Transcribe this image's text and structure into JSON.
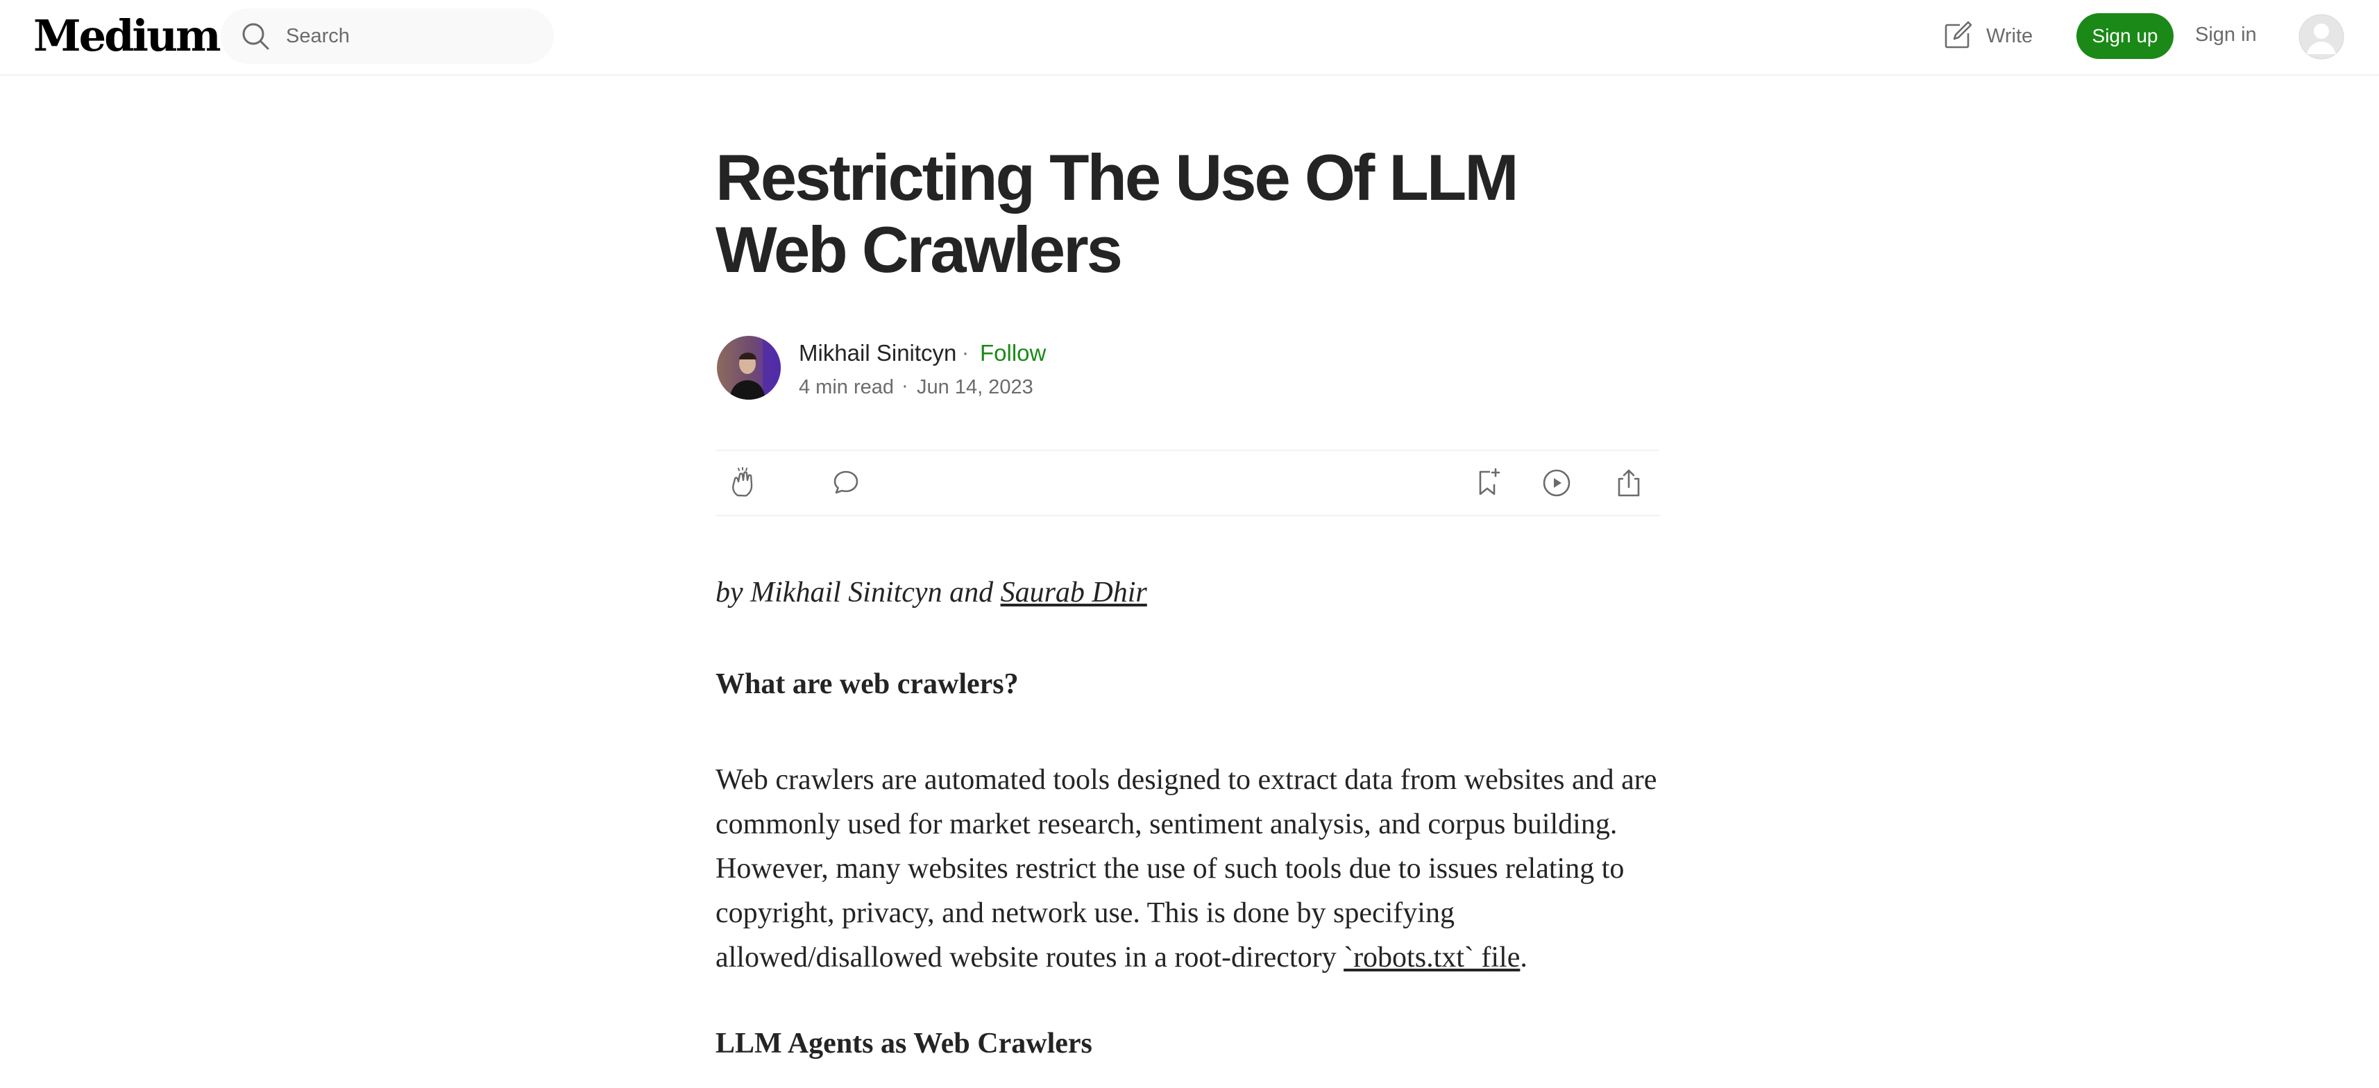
{
  "nav": {
    "logo": "Medium",
    "search_placeholder": "Search",
    "write_label": "Write",
    "signup_label": "Sign up",
    "signin_label": "Sign in"
  },
  "article": {
    "title": "Restricting The Use Of LLM Web Crawlers",
    "author": "Mikhail Sinitcyn",
    "follow_label": "Follow",
    "separator": "·",
    "read_time": "4 min read",
    "date": "Jun 14, 2023",
    "byline_prefix": "by Mikhail Sinitcyn and ",
    "byline_link": "Saurab Dhir",
    "heading_1": "What are web crawlers?",
    "paragraph_1_text": "Web crawlers are automated tools designed to extract data from websites and are commonly used for market research, sentiment analysis, and corpus building. However, many websites restrict the use of such tools due to issues relating to copyright, privacy, and network use. This is done by specifying allowed/disallowed website routes in a root-directory ",
    "paragraph_1_link": "`robots.txt` file",
    "paragraph_1_end": ".",
    "heading_2": "LLM Agents as Web Crawlers"
  },
  "actions": [
    "clap-icon",
    "comment-icon",
    "bookmark-icon",
    "listen-icon",
    "share-icon"
  ],
  "colors": {
    "brand_green": "#1a8917",
    "text": "#242424",
    "muted": "#6b6b6b"
  }
}
